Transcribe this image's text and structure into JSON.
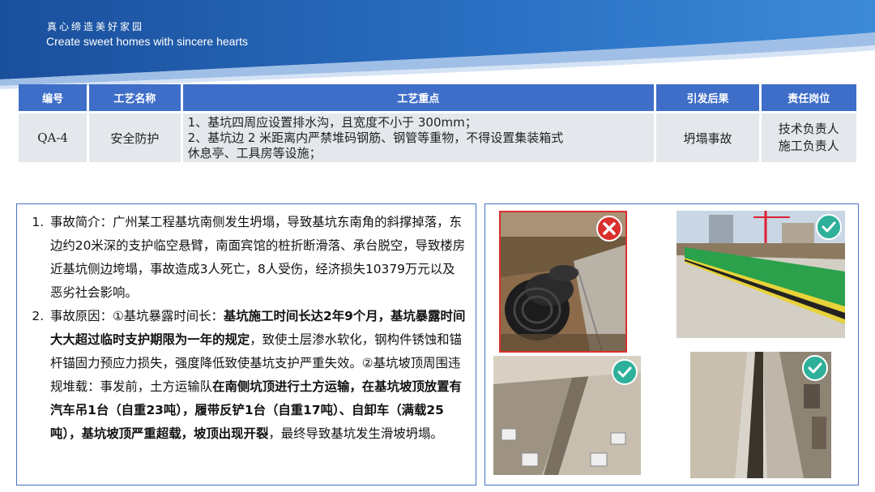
{
  "header": {
    "slogan_cn": "真心缔造美好家园",
    "slogan_en": "Create sweet homes with sincere hearts"
  },
  "process_table": {
    "columns": [
      "编号",
      "工艺名称",
      "工艺重点",
      "引发后果",
      "责任岗位"
    ],
    "row": {
      "code": "QA-4",
      "name": "安全防护",
      "key_points": [
        "1、基坑四周应设置排水沟，且宽度不小于 300mm；",
        "2、基坑边 2 米距离内严禁堆码钢筋、钢管等重物，不得设置集装箱式",
        "休息亭、工具房等设施；"
      ],
      "consequence": "坍塌事故",
      "responsible": [
        "技术负责人",
        "施工负责人"
      ]
    }
  },
  "incident": {
    "item1": "事故简介：广州某工程基坑南侧发生坍塌，导致基坑东南角的斜撑掉落，东边约20米深的支护临空悬臂，南面宾馆的桩折断滑落、承台脱空，导致楼房近基坑侧边垮塌，事故造成3人死亡，8人受伤，经济损失10379万元以及恶劣社会影响。",
    "item2": {
      "p1": "事故原因：①基坑暴露时间长：",
      "b1": "基坑施工时间长达2年9个月，基坑暴露时间大大超过临时支护期限为一年的规定",
      "p2": "，致使土层渗水软化，钢构件锈蚀和锚杆锚固力预应力损失，强度降低致使基坑支护严重失效。②基坑坡顶周围违规堆载：事发前，土方运输队",
      "b2": "在南侧坑顶进行土方运输，在基坑坡顶放置有汽车吊1台（自重23吨），履带反铲1台（自重17吨）、自卸车（满载25吨），基坑坡顶严重超载，坡顶出现开裂",
      "p3": "，最终导致基坑发生滑坡坍塌。"
    }
  },
  "photos": [
    {
      "id": "pipes-at-pit-edge",
      "status": "wrong",
      "badge_icon": "red-cross-icon"
    },
    {
      "id": "green-safety-fence",
      "status": "correct",
      "badge_icon": "check-icon"
    },
    {
      "id": "drainage-ditch-top",
      "status": "correct",
      "badge_icon": "check-icon"
    },
    {
      "id": "drainage-channel",
      "status": "correct",
      "badge_icon": "check-icon"
    }
  ],
  "colors": {
    "brand_blue": "#1f5fb8",
    "header_cell": "#3f6ec9",
    "body_cell": "#e4e7ec",
    "panel_border": "#4a72c4",
    "wrong_red": "#d9302c",
    "correct_teal": "#2eb09a"
  }
}
